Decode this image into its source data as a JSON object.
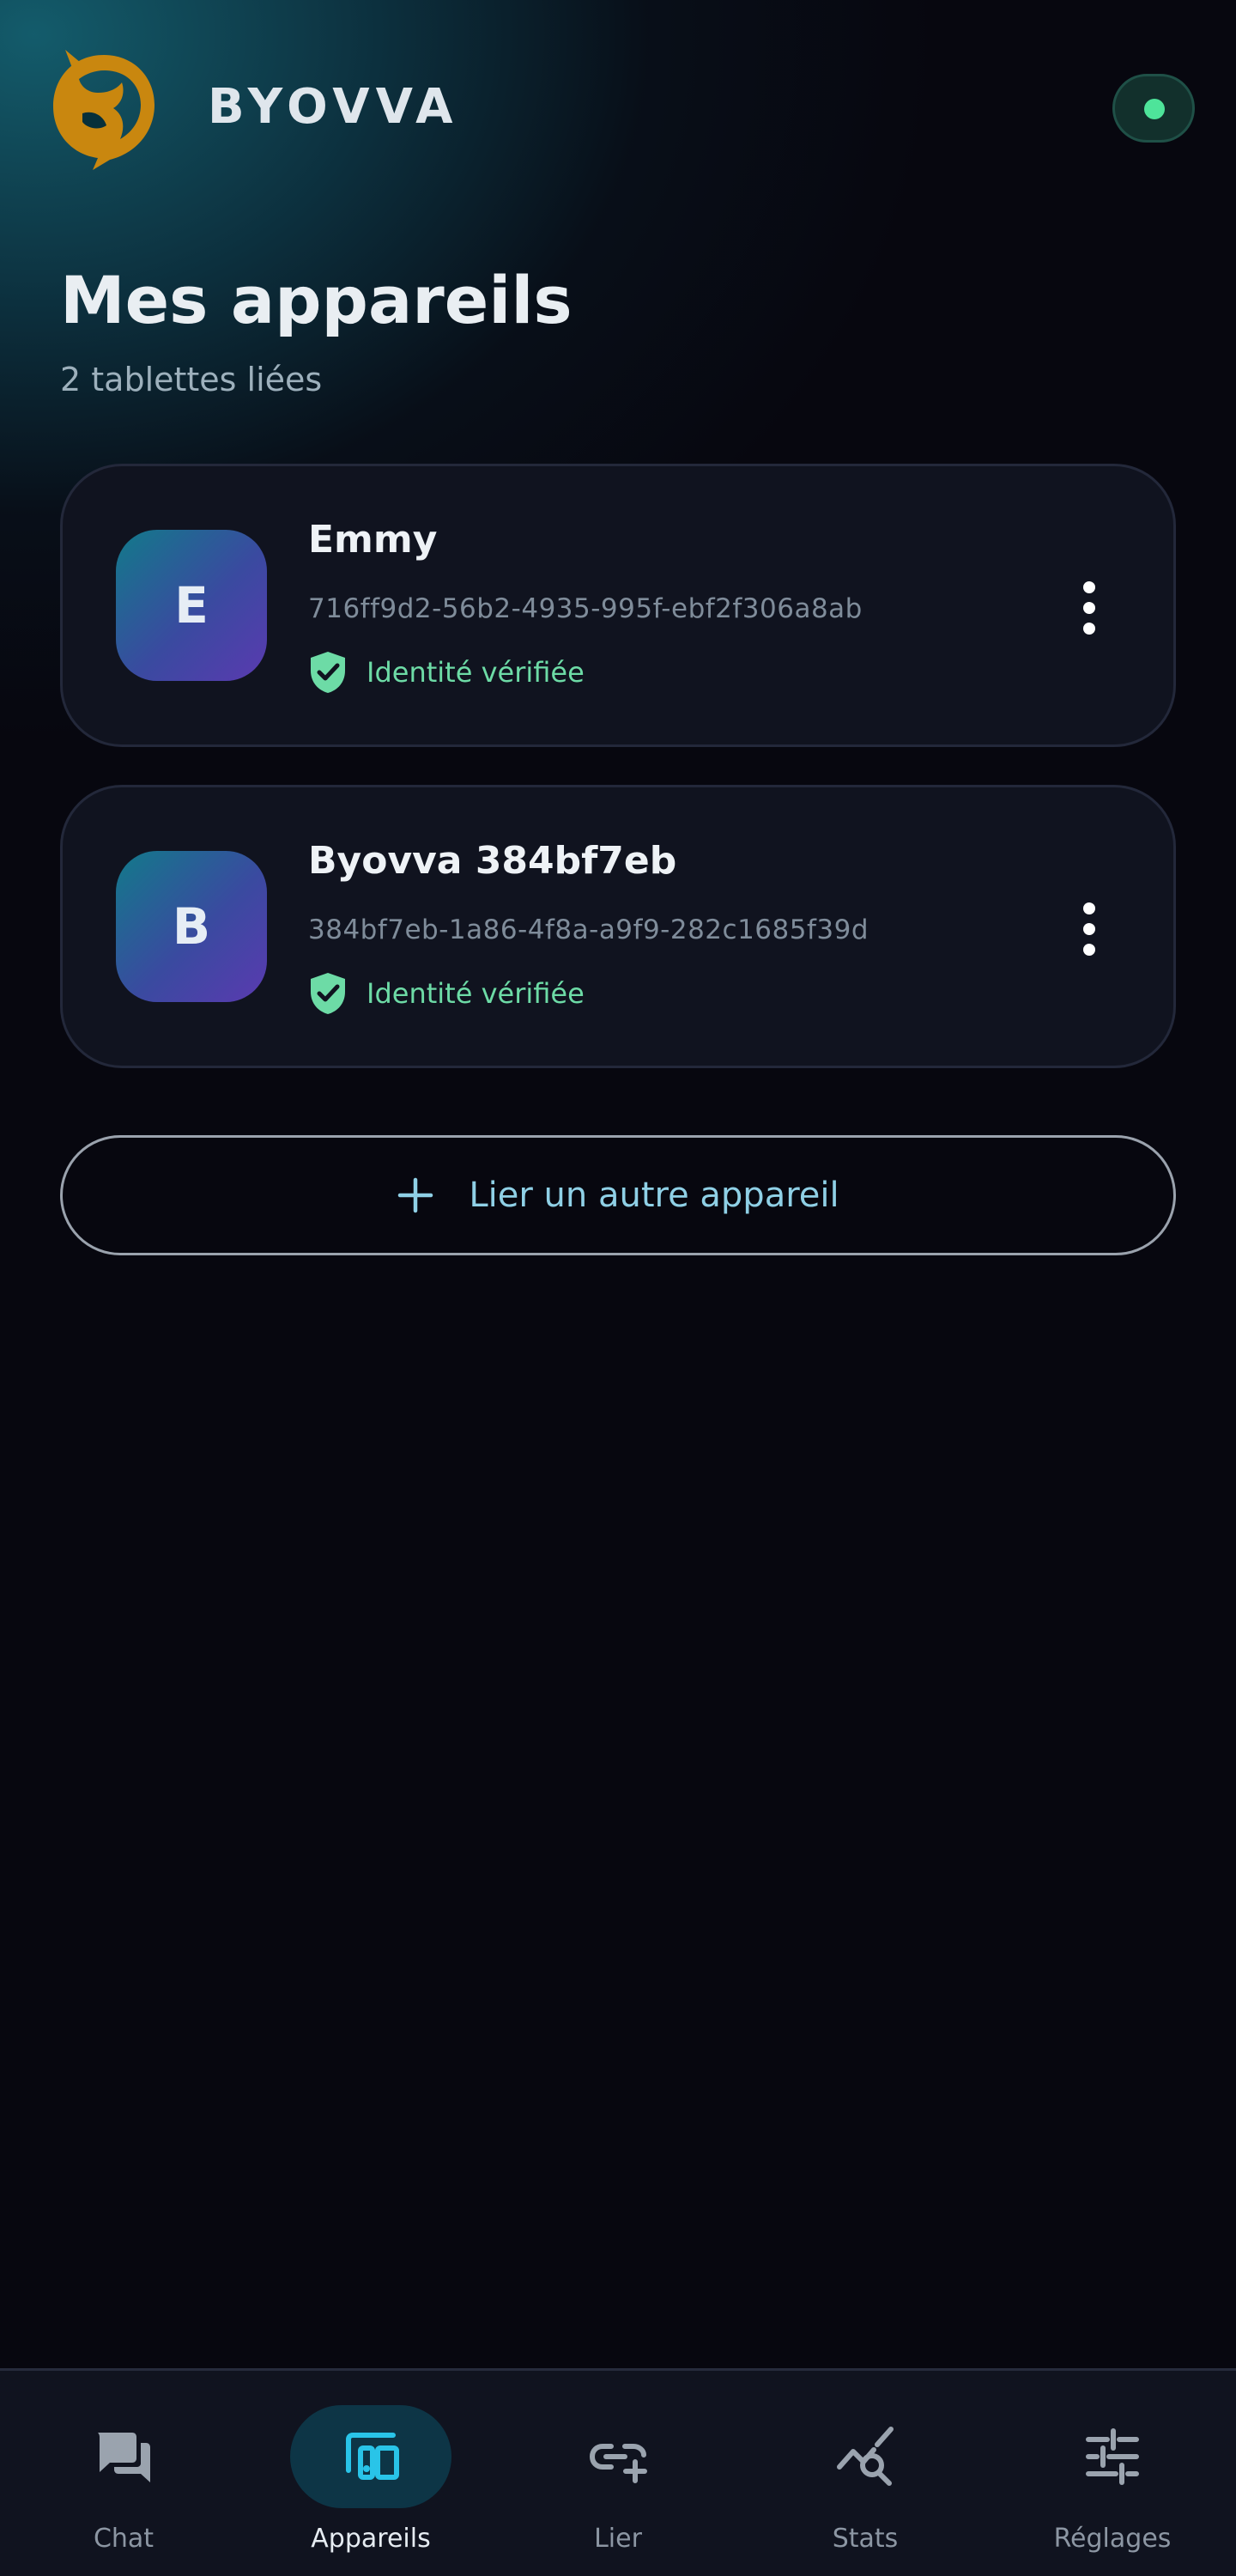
{
  "app": {
    "brand": "BYOVVA",
    "status": "online"
  },
  "page": {
    "title": "Mes appareils",
    "subtitle": "2 tablettes liées"
  },
  "devices": [
    {
      "initial": "E",
      "name": "Emmy",
      "id": "716ff9d2-56b2-4935-995f-ebf2f306a8ab",
      "verified_label": "Identité vérifiée"
    },
    {
      "initial": "B",
      "name": "Byovva 384bf7eb",
      "id": "384bf7eb-1a86-4f8a-a9f9-282c1685f39d",
      "verified_label": "Identité vérifiée"
    }
  ],
  "link_button": {
    "label": "Lier un autre appareil"
  },
  "nav": [
    {
      "label": "Chat",
      "icon": "chat-icon",
      "active": false
    },
    {
      "label": "Appareils",
      "icon": "devices-icon",
      "active": true
    },
    {
      "label": "Lier",
      "icon": "link-add-icon",
      "active": false
    },
    {
      "label": "Stats",
      "icon": "stats-search-icon",
      "active": false
    },
    {
      "label": "Réglages",
      "icon": "sliders-icon",
      "active": false
    }
  ],
  "colors": {
    "background": "#07070f",
    "logo": "#c9870f",
    "status_dot": "#4ee49a",
    "verified": "#6ddba6",
    "active_nav": "#29c4e8",
    "link_text": "#8fd0e6"
  }
}
